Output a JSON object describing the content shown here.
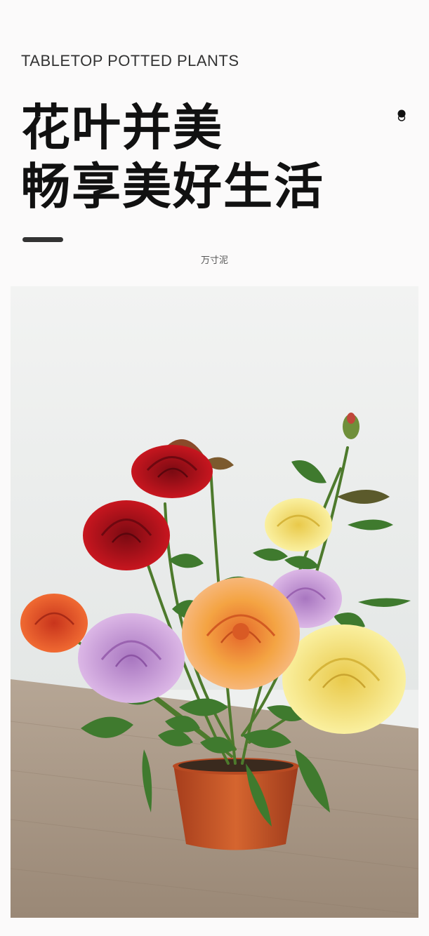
{
  "header": {
    "eyebrow": "TABLETOP POTTED PLANTS",
    "headline_line1": "花叶并美",
    "headline_line2": "畅享美好生活",
    "brand": "万寸泥"
  },
  "photo": {
    "subject": "potted-mini-roses",
    "colors": {
      "wall": "#eef0ef",
      "table": "#a89684",
      "pot": "#c9552a",
      "leaf": "#3f7a2e",
      "red_rose": "#b5121b",
      "orange_rose": "#f09a3e",
      "yellow_rose": "#f3e27a",
      "purple_rose": "#c79ad6",
      "coral_rose": "#e85a2c"
    }
  }
}
